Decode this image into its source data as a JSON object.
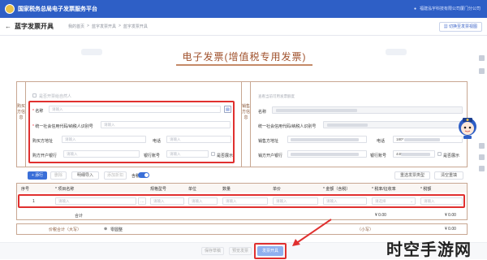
{
  "header": {
    "title": "国家税务总局电子发票服务平台",
    "user": "福建泓宇科技有限公司厦门分公司"
  },
  "toolbar": {
    "page_title": "蓝字发票开具",
    "crumbs": [
      "我的首页",
      "蓝字发票开具",
      "蓝字发票开具"
    ],
    "switch_label": "切换至发票视图"
  },
  "invoice": {
    "title": "电子发票(增值税专用发票)"
  },
  "buyer": {
    "side_label": "购买方信息",
    "natural_person_label": "是否开票给自然人",
    "name_label": "名称",
    "name_placeholder": "请输入",
    "tax_id_label": "统一社会信用代码/纳税人识别号",
    "tax_id_placeholder": "请输入",
    "address_label": "购买方地址",
    "address_placeholder": "请输入",
    "phone_label": "电话",
    "phone_placeholder": "请输入",
    "bank_label": "购方开户银行",
    "bank_placeholder": "请输入",
    "account_label": "银行账号",
    "account_placeholder": "请输入",
    "show_label": "是否展示"
  },
  "seller": {
    "side_label": "销售方信息",
    "hint": "查看当前可用发票额度",
    "name_label": "名称",
    "tax_id_label": "统一社会信用代码/纳税人识别号",
    "address_label": "销售方地址",
    "phone_label": "电话",
    "phone_value": "180*",
    "bank_label": "销方开户银行",
    "account_label": "银行账号",
    "account_value": "440",
    "show_label": "是否展示"
  },
  "items_toolbar": {
    "add_row": "+ 添行",
    "delete_row": "删除",
    "copy_import": "明细导入",
    "discount": "添加折扣",
    "tax_toggle": "含税",
    "clear_type": "重选发票类型",
    "clear_all": "清空重填"
  },
  "items_table": {
    "headers": [
      "序号",
      "* 项目名称",
      "规格型号",
      "单位",
      "数量",
      "单价",
      "* 金额（含税）",
      "* 税率/征收率",
      "* 税额"
    ],
    "rows": [
      {
        "no": "1",
        "name": "请输入",
        "spec": "请输入",
        "unit": "请输入",
        "qty": "请输入",
        "price": "请输入",
        "amount": "请输入",
        "rate": "请选择",
        "tax": "请输入"
      }
    ],
    "total_label": "合计",
    "total_amount": "¥ 0.00",
    "total_tax": "¥ 0.00"
  },
  "summary": {
    "total_in_words_label": "价税合计（大写）",
    "total_in_words_value": "零圆整",
    "total_small_label": "（小写）",
    "total_small_value": "¥ 0.00"
  },
  "actions": {
    "save_draft": "保存草稿",
    "preview": "预览发票",
    "issue": "发票开具"
  },
  "watermark": "时空手游网",
  "colors": {
    "brand_blue": "#2e5fc6",
    "invoice_brown": "#a0522d",
    "highlight_red": "#e0302f",
    "primary_button": "#3a6fd8"
  }
}
